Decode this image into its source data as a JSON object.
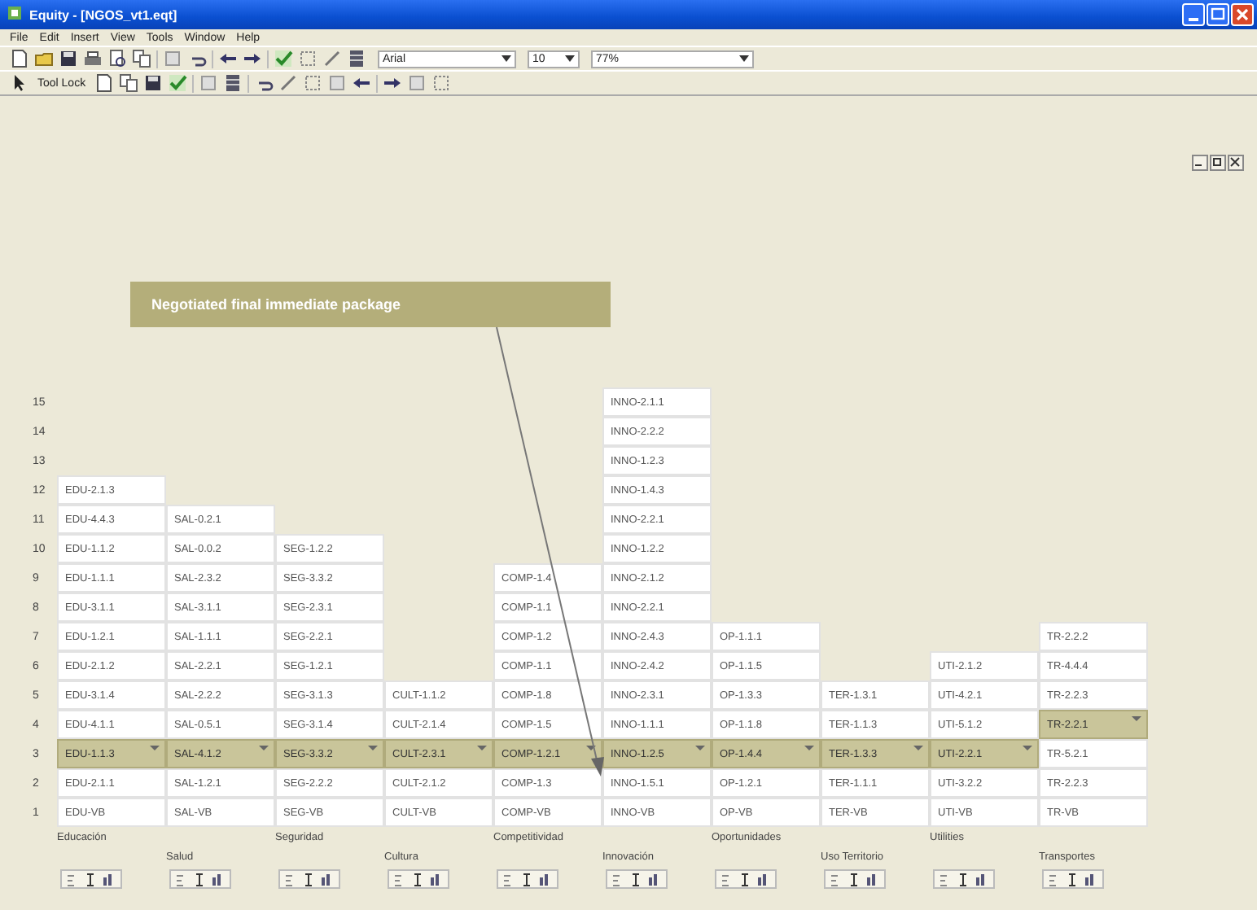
{
  "window": {
    "title": "Equity - [NGOS_vt1.eqt]"
  },
  "menu": [
    "File",
    "Edit",
    "Insert",
    "View",
    "Tools",
    "Window",
    "Help"
  ],
  "toolbar": {
    "font": "Arial",
    "font_size": "10",
    "zoom": "77%"
  },
  "toolbar2": {
    "tool_lock": "Tool Lock"
  },
  "callout": {
    "text": "Negotiated final immediate package"
  },
  "row_labels": [
    "15",
    "14",
    "13",
    "12",
    "11",
    "10",
    "9",
    "8",
    "7",
    "6",
    "5",
    "4",
    "3",
    "2",
    "1"
  ],
  "areas": [
    {
      "name": "Educación",
      "cells": [
        {
          "text": "EDU-2.1.3",
          "selected": false
        },
        {
          "text": "EDU-4.4.3",
          "selected": false
        },
        {
          "text": "EDU-1.1.2",
          "selected": false
        },
        {
          "text": "EDU-1.1.1",
          "selected": false
        },
        {
          "text": "EDU-3.1.1",
          "selected": false
        },
        {
          "text": "EDU-1.2.1",
          "selected": false
        },
        {
          "text": "EDU-2.1.2",
          "selected": false
        },
        {
          "text": "EDU-3.1.4",
          "selected": false
        },
        {
          "text": "EDU-4.1.1",
          "selected": false
        },
        {
          "text": "EDU-1.1.3",
          "selected": true
        },
        {
          "text": "EDU-2.1.1",
          "selected": false
        },
        {
          "text": "EDU-VB",
          "selected": false
        }
      ]
    },
    {
      "name": "Salud",
      "cells": [
        {
          "text": "SAL-0.2.1",
          "selected": false
        },
        {
          "text": "SAL-0.0.2",
          "selected": false
        },
        {
          "text": "SAL-2.3.2",
          "selected": false
        },
        {
          "text": "SAL-3.1.1",
          "selected": false
        },
        {
          "text": "SAL-1.1.1",
          "selected": false
        },
        {
          "text": "SAL-2.2.1",
          "selected": false
        },
        {
          "text": "SAL-2.2.2",
          "selected": false
        },
        {
          "text": "SAL-0.5.1",
          "selected": false
        },
        {
          "text": "SAL-4.1.2",
          "selected": true
        },
        {
          "text": "SAL-1.2.1",
          "selected": false
        },
        {
          "text": "SAL-VB",
          "selected": false
        }
      ]
    },
    {
      "name": "Seguridad",
      "cells": [
        {
          "text": "SEG-1.2.2",
          "selected": false
        },
        {
          "text": "SEG-3.3.2",
          "selected": false
        },
        {
          "text": "SEG-2.3.1",
          "selected": false
        },
        {
          "text": "SEG-2.2.1",
          "selected": false
        },
        {
          "text": "SEG-1.2.1",
          "selected": false
        },
        {
          "text": "SEG-3.1.3",
          "selected": false
        },
        {
          "text": "SEG-3.1.4",
          "selected": false
        },
        {
          "text": "SEG-3.3.2",
          "selected": true
        },
        {
          "text": "SEG-2.2.2",
          "selected": false
        },
        {
          "text": "SEG-VB",
          "selected": false
        }
      ]
    },
    {
      "name": "Cultura",
      "cells": [
        {
          "text": "CULT-1.1.2",
          "selected": false
        },
        {
          "text": "CULT-2.1.4",
          "selected": false
        },
        {
          "text": "CULT-2.3.1",
          "selected": true
        },
        {
          "text": "CULT-2.1.2",
          "selected": false
        },
        {
          "text": "CULT-VB",
          "selected": false
        }
      ]
    },
    {
      "name": "Competitividad",
      "cells": [
        {
          "text": "COMP-1.4",
          "selected": false
        },
        {
          "text": "COMP-1.1",
          "selected": false
        },
        {
          "text": "COMP-1.2",
          "selected": false
        },
        {
          "text": "COMP-1.1",
          "selected": false
        },
        {
          "text": "COMP-1.8",
          "selected": false
        },
        {
          "text": "COMP-1.5",
          "selected": false
        },
        {
          "text": "COMP-1.2.1",
          "selected": true
        },
        {
          "text": "COMP-1.3",
          "selected": false
        },
        {
          "text": "COMP-VB",
          "selected": false
        }
      ]
    },
    {
      "name": "Innovación",
      "cells": [
        {
          "text": "INNO-2.1.1",
          "selected": false
        },
        {
          "text": "INNO-2.2.2",
          "selected": false
        },
        {
          "text": "INNO-1.2.3",
          "selected": false
        },
        {
          "text": "INNO-1.4.3",
          "selected": false
        },
        {
          "text": "INNO-2.2.1",
          "selected": false
        },
        {
          "text": "INNO-1.2.2",
          "selected": false
        },
        {
          "text": "INNO-2.1.2",
          "selected": false
        },
        {
          "text": "INNO-2.2.1",
          "selected": false
        },
        {
          "text": "INNO-2.4.3",
          "selected": false
        },
        {
          "text": "INNO-2.4.2",
          "selected": false
        },
        {
          "text": "INNO-2.3.1",
          "selected": false
        },
        {
          "text": "INNO-1.1.1",
          "selected": false
        },
        {
          "text": "INNO-1.2.5",
          "selected": true
        },
        {
          "text": "INNO-1.5.1",
          "selected": false
        },
        {
          "text": "INNO-VB",
          "selected": false
        }
      ]
    },
    {
      "name": "Oportunidades",
      "cells": [
        {
          "text": "OP-1.1.1",
          "selected": false
        },
        {
          "text": "OP-1.1.5",
          "selected": false
        },
        {
          "text": "OP-1.3.3",
          "selected": false
        },
        {
          "text": "OP-1.1.8",
          "selected": false
        },
        {
          "text": "OP-1.4.4",
          "selected": true
        },
        {
          "text": "OP-1.2.1",
          "selected": false
        },
        {
          "text": "OP-VB",
          "selected": false
        }
      ]
    },
    {
      "name": "Uso Territorio",
      "cells": [
        {
          "text": "TER-1.3.1",
          "selected": false
        },
        {
          "text": "TER-1.1.3",
          "selected": false
        },
        {
          "text": "TER-1.3.3",
          "selected": true
        },
        {
          "text": "TER-1.1.1",
          "selected": false
        },
        {
          "text": "TER-VB",
          "selected": false
        }
      ]
    },
    {
      "name": "Utilities",
      "cells": [
        {
          "text": "UTI-2.1.2",
          "selected": false
        },
        {
          "text": "UTI-4.2.1",
          "selected": false
        },
        {
          "text": "UTI-5.1.2",
          "selected": false
        },
        {
          "text": "UTI-2.2.1",
          "selected": true
        },
        {
          "text": "UTI-3.2.2",
          "selected": false
        },
        {
          "text": "UTI-VB",
          "selected": false
        }
      ]
    },
    {
      "name": "Transportes",
      "cells": [
        {
          "text": "TR-2.2.2",
          "selected": false
        },
        {
          "text": "TR-4.4.4",
          "selected": false
        },
        {
          "text": "TR-2.2.3",
          "selected": false
        },
        {
          "text": "TR-2.2.1",
          "selected": true
        },
        {
          "text": "TR-5.2.1",
          "selected": false
        },
        {
          "text": "TR-2.2.3",
          "selected": false
        },
        {
          "text": "TR-VB",
          "selected": false
        }
      ]
    }
  ]
}
